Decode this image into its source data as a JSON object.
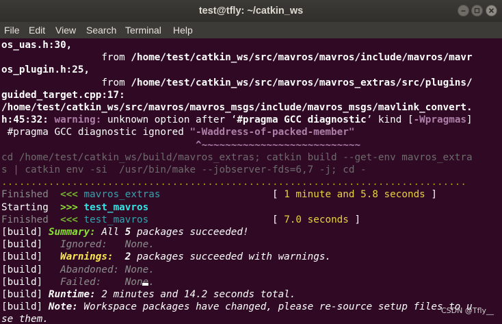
{
  "window": {
    "title": "test@tfly: ~/catkin_ws",
    "buttons": [
      "minimize-icon",
      "maximize-icon",
      "close-icon"
    ]
  },
  "menu": [
    "File",
    "Edit",
    "View",
    "Search",
    "Terminal",
    "Help"
  ],
  "terminal": {
    "lines": [
      [
        {
          "t": "os_uas.h:30,",
          "c": "bw"
        }
      ],
      [
        {
          "t": "                 from ",
          "c": "w"
        },
        {
          "t": "/home/test/catkin_ws/src/mavros/mavros/include/mavros/mavr",
          "c": "bw"
        }
      ],
      [
        {
          "t": "os_plugin.h:25,",
          "c": "bw"
        }
      ],
      [
        {
          "t": "                 from ",
          "c": "w"
        },
        {
          "t": "/home/test/catkin_ws/src/mavros/mavros_extras/src/plugins/",
          "c": "bw"
        }
      ],
      [
        {
          "t": "guided_target.cpp:17:",
          "c": "bw"
        }
      ],
      [
        {
          "t": "/home/test/catkin_ws/src/mavros/mavros_msgs/include/mavros_msgs/mavlink_convert.",
          "c": "bw"
        }
      ],
      [
        {
          "t": "h:45:32: ",
          "c": "bw"
        },
        {
          "t": "warning: ",
          "c": "magb"
        },
        {
          "t": "unknown option after ‘",
          "c": "w"
        },
        {
          "t": "#pragma GCC diagnostic",
          "c": "bw"
        },
        {
          "t": "’ kind [",
          "c": "w"
        },
        {
          "t": "-Wpragmas",
          "c": "magb"
        },
        {
          "t": "]",
          "c": "w"
        }
      ],
      [
        {
          "t": " #pragma GCC diagnostic ignored ",
          "c": "w"
        },
        {
          "t": "\"-Waddress-of-packed-member\"",
          "c": "magb"
        }
      ],
      [
        {
          "t": "                                 ^~~~~~~~~~~~~~~~~~~~~~~~~~~~",
          "c": "magb"
        }
      ],
      [
        {
          "t": "cd /home/test/catkin_ws/build/mavros_extras; catkin build --get-env mavros_extra",
          "c": "dgrey"
        }
      ],
      [
        {
          "t": "s | catkin env -si  /usr/bin/make --jobserver-fds=6,7 -j; cd -",
          "c": "dgrey"
        }
      ],
      [
        {
          "t": "...............................................................................",
          "c": "olive"
        }
      ],
      [
        {
          "t": "Finished",
          "c": "g"
        },
        {
          "t": "  <<< ",
          "c": "grn"
        },
        {
          "t": "mavros_extras",
          "c": "cyan"
        },
        {
          "t": "                   [ ",
          "c": "w"
        },
        {
          "t": "1 minute and 5.8 seconds",
          "c": "yel"
        },
        {
          "t": " ]",
          "c": "w"
        }
      ],
      [
        {
          "t": "Starting",
          "c": "w"
        },
        {
          "t": "  >>> ",
          "c": "grnb"
        },
        {
          "t": "test_mavros",
          "c": "cyanb"
        }
      ],
      [
        {
          "t": "Finished",
          "c": "g"
        },
        {
          "t": "  <<< ",
          "c": "grn"
        },
        {
          "t": "test_mavros",
          "c": "cyan"
        },
        {
          "t": "                     [ ",
          "c": "w"
        },
        {
          "t": "7.0 seconds",
          "c": "yel"
        },
        {
          "t": " ]",
          "c": "w"
        }
      ],
      [
        {
          "t": "[build] ",
          "c": "w"
        },
        {
          "t": "Summary:",
          "c": "grnb i"
        },
        {
          "t": " All ",
          "c": "w i"
        },
        {
          "t": "5",
          "c": "bw i"
        },
        {
          "t": " packages succeeded!",
          "c": "w i"
        }
      ],
      [
        {
          "t": "[build] ",
          "c": "w"
        },
        {
          "t": "  Ignored:   None.",
          "c": "gy i"
        }
      ],
      [
        {
          "t": "[build] ",
          "c": "w"
        },
        {
          "t": "  Warnings:",
          "c": "yelb i"
        },
        {
          "t": "  ",
          "c": "w"
        },
        {
          "t": "2",
          "c": "bw i"
        },
        {
          "t": " packages succeeded with warnings.",
          "c": "w i"
        }
      ],
      [
        {
          "t": "[build] ",
          "c": "w"
        },
        {
          "t": "  Abandoned: None.",
          "c": "gy i"
        }
      ],
      [
        {
          "t": "[build] ",
          "c": "w"
        },
        {
          "t": "  Failed:    None.",
          "c": "gy i"
        }
      ],
      [
        {
          "t": "[build] ",
          "c": "w"
        },
        {
          "t": "Runtime:",
          "c": "bw i"
        },
        {
          "t": " 2 minutes and 14.2 seconds total.",
          "c": "w i"
        }
      ],
      [
        {
          "t": "[build] ",
          "c": "w"
        },
        {
          "t": "Note:",
          "c": "bw i"
        },
        {
          "t": " Workspace packages have changed, please re-source setup files to u",
          "c": "w i"
        }
      ],
      [
        {
          "t": "se them.",
          "c": "w i"
        }
      ]
    ]
  },
  "watermark": "CSDN @Tfly__"
}
